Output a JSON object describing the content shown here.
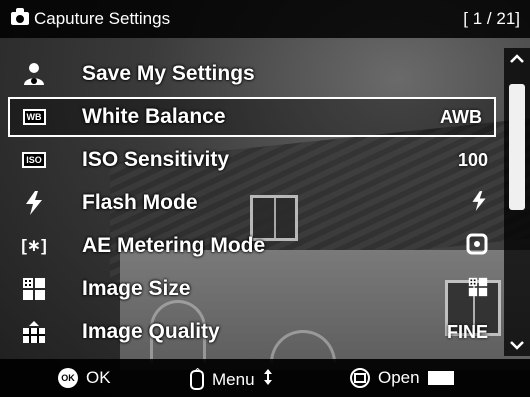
{
  "header": {
    "title": "Caputure Settings",
    "page_indicator": "[ 1 / 21]"
  },
  "menu": {
    "items": [
      {
        "icon": "person-save-icon",
        "label": "Save My Settings",
        "value": ""
      },
      {
        "icon": "wb-icon",
        "icon_text": "WB",
        "label": "White Balance",
        "value": "AWB",
        "selected": true
      },
      {
        "icon": "iso-icon",
        "icon_text": "ISO",
        "label": "ISO Sensitivity",
        "value": "100"
      },
      {
        "icon": "flash-icon",
        "label": "Flash Mode",
        "value": "ϟ"
      },
      {
        "icon": "ae-metering-icon",
        "icon_text": "[∗]",
        "label": "AE Metering Mode",
        "value": "[∙]"
      },
      {
        "icon": "image-size-icon",
        "label": "Image Size",
        "value": ""
      },
      {
        "icon": "image-quality-icon",
        "label": "Image Quality",
        "value": "FINE"
      }
    ]
  },
  "footer": {
    "ok_icon_text": "OK",
    "ok_label": "OK",
    "menu_label": "Menu",
    "open_label": "Open"
  }
}
